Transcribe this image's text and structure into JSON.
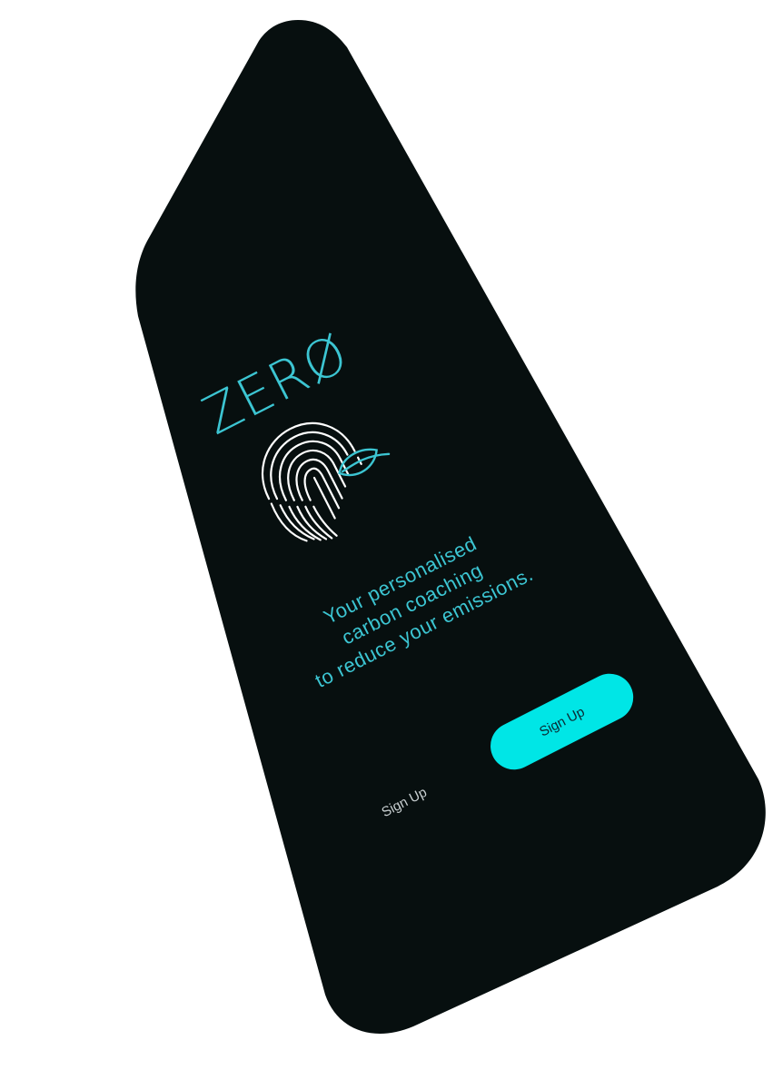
{
  "app": {
    "name": "ZERØ"
  },
  "tagline": {
    "line1": "Your personalised",
    "line2": "carbon coaching",
    "line3": "to reduce your emissions."
  },
  "actions": {
    "secondary_label": "Sign Up",
    "primary_label": "Sign Up"
  },
  "icons": {
    "logo_mark": "fingerprint-leaf-icon"
  },
  "colors": {
    "background": "#070f0f",
    "accent": "#00e6e6",
    "text_accent": "#3cc5d2",
    "fingerprint": "#ffffff",
    "secondary_text": "#c9d0d2",
    "primary_button_text": "#0b2a33"
  }
}
